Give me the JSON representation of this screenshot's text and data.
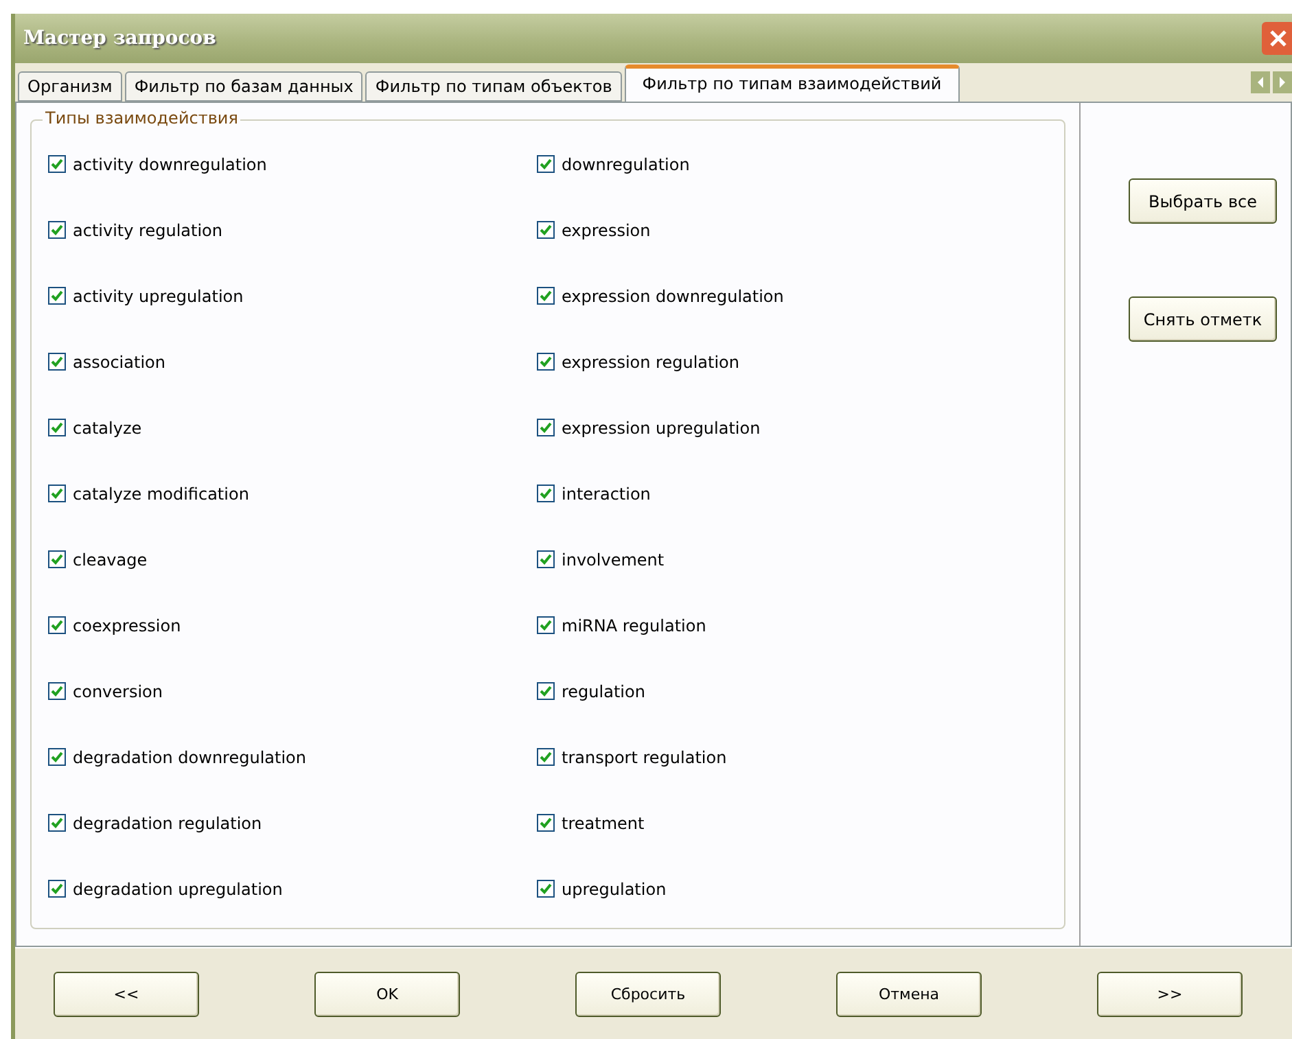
{
  "window": {
    "title": "Мастер запросов"
  },
  "tabs": [
    {
      "label": "Организм",
      "selected": false
    },
    {
      "label": "Фильтр по базам данных",
      "selected": false
    },
    {
      "label": "Фильтр по типам объектов",
      "selected": false
    },
    {
      "label": "Фильтр по типам взаимодействий",
      "selected": true
    }
  ],
  "group": {
    "title": "Типы взаимодействия",
    "columns": [
      [
        {
          "label": "activity downregulation",
          "checked": true
        },
        {
          "label": "activity regulation",
          "checked": true
        },
        {
          "label": "activity upregulation",
          "checked": true
        },
        {
          "label": "association",
          "checked": true
        },
        {
          "label": "catalyze",
          "checked": true
        },
        {
          "label": "catalyze modification",
          "checked": true
        },
        {
          "label": "cleavage",
          "checked": true
        },
        {
          "label": "coexpression",
          "checked": true
        },
        {
          "label": "conversion",
          "checked": true
        },
        {
          "label": "degradation downregulation",
          "checked": true
        },
        {
          "label": "degradation regulation",
          "checked": true
        },
        {
          "label": "degradation upregulation",
          "checked": true
        }
      ],
      [
        {
          "label": "downregulation",
          "checked": true
        },
        {
          "label": "expression",
          "checked": true
        },
        {
          "label": "expression downregulation",
          "checked": true
        },
        {
          "label": "expression regulation",
          "checked": true
        },
        {
          "label": "expression upregulation",
          "checked": true
        },
        {
          "label": "interaction",
          "checked": true
        },
        {
          "label": "involvement",
          "checked": true
        },
        {
          "label": "miRNA regulation",
          "checked": true
        },
        {
          "label": "regulation",
          "checked": true
        },
        {
          "label": "transport regulation",
          "checked": true
        },
        {
          "label": "treatment",
          "checked": true
        },
        {
          "label": "upregulation",
          "checked": true
        }
      ]
    ]
  },
  "side_buttons": [
    "Выбрать все",
    "Снять отметк"
  ],
  "footer_buttons": [
    "<<",
    "OK",
    "Сбросить",
    "Отмена",
    ">>"
  ]
}
